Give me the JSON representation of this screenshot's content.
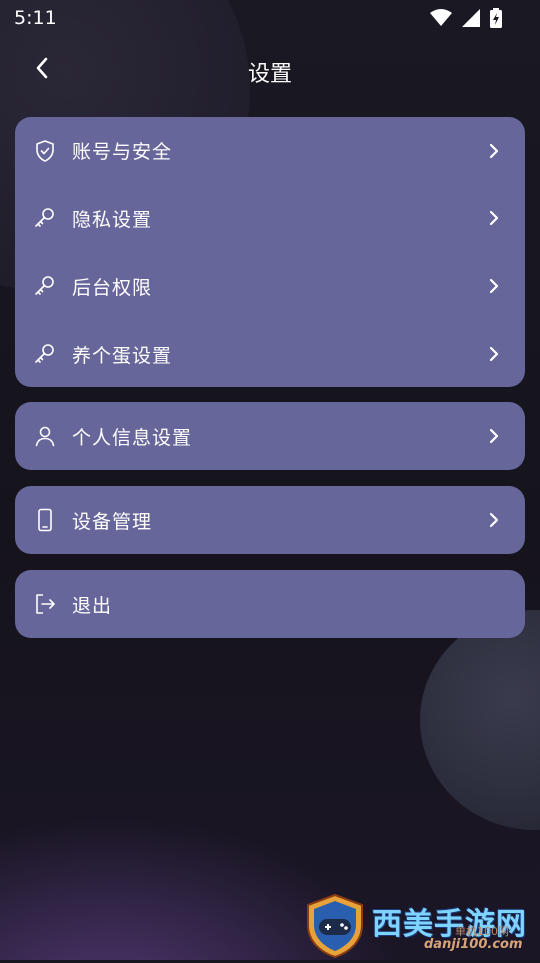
{
  "status_bar": {
    "time": "5:11"
  },
  "header": {
    "title": "设置"
  },
  "menu_group_1": [
    {
      "label": "账号与安全",
      "icon": "shield-icon"
    },
    {
      "label": "隐私设置",
      "icon": "key-icon"
    },
    {
      "label": "后台权限",
      "icon": "key-icon"
    },
    {
      "label": "养个蛋设置",
      "icon": "key-icon"
    }
  ],
  "personal": {
    "label": "个人信息设置",
    "icon": "person-icon"
  },
  "device": {
    "label": "设备管理",
    "icon": "phone-icon"
  },
  "logout": {
    "label": "退出",
    "icon": "logout-icon"
  },
  "watermark": {
    "brand": "西美手游网",
    "sub": "单机100网",
    "url": "danji100.com"
  },
  "colors": {
    "card": "#66669a",
    "background": "#17151f"
  }
}
